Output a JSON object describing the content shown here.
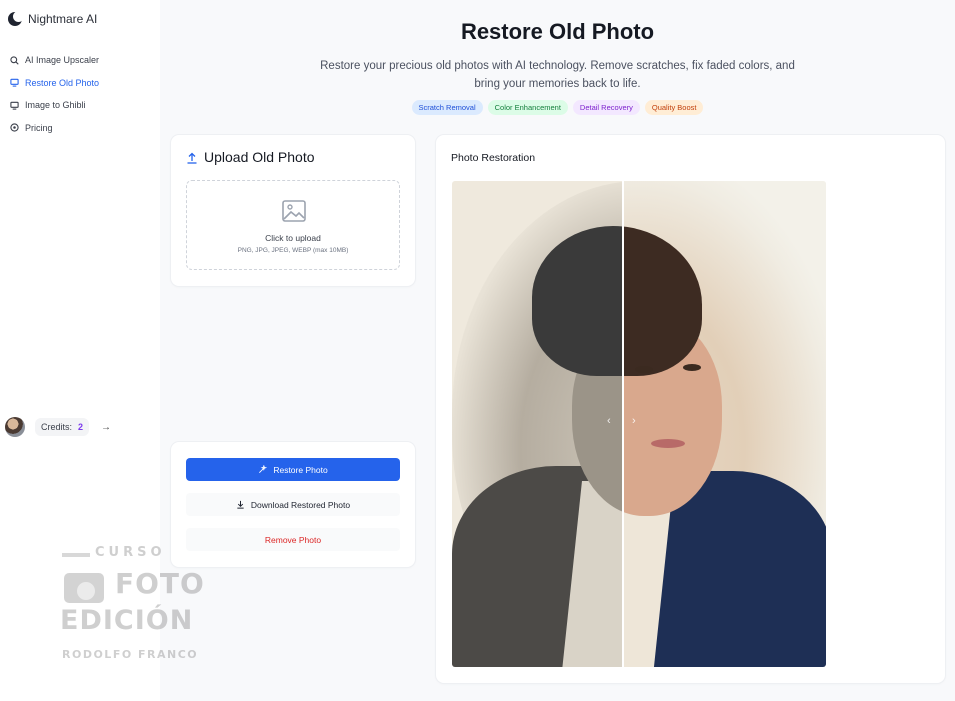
{
  "app": {
    "name": "Nightmare AI"
  },
  "sidebar": {
    "items": [
      {
        "label": "AI Image Upscaler",
        "icon": "zoom-icon",
        "active": false
      },
      {
        "label": "Restore Old Photo",
        "icon": "monitor-icon",
        "active": true
      },
      {
        "label": "Image to Ghibli",
        "icon": "monitor-icon",
        "active": false
      },
      {
        "label": "Pricing",
        "icon": "coin-icon",
        "active": false
      }
    ],
    "credits_label": "Credits:",
    "credits_value": "2"
  },
  "header": {
    "title": "Restore Old Photo",
    "subtitle": "Restore your precious old photos with AI technology. Remove scratches, fix faded colors, and bring your memories back to life.",
    "tags": [
      {
        "label": "Scratch Removal",
        "bg": "#dbeafe",
        "fg": "#1d4ed8"
      },
      {
        "label": "Color Enhancement",
        "bg": "#dcfce7",
        "fg": "#15803d"
      },
      {
        "label": "Detail Recovery",
        "bg": "#f3e8ff",
        "fg": "#7e22ce"
      },
      {
        "label": "Quality Boost",
        "bg": "#ffedd5",
        "fg": "#c2410c"
      }
    ]
  },
  "upload": {
    "title": "Upload Old Photo",
    "main_text": "Click to upload",
    "sub_text": "PNG, JPG, JPEG, WEBP (max 10MB)"
  },
  "actions": {
    "restore_label": "Restore Photo",
    "download_label": "Download Restored Photo",
    "remove_label": "Remove Photo"
  },
  "restoration": {
    "title": "Photo Restoration",
    "accent": "#2563eb"
  },
  "watermark": {
    "line1": "CURSO",
    "line2": "FOTO",
    "line3": "EDICIÓN",
    "line4": "RODOLFO FRANCO"
  }
}
